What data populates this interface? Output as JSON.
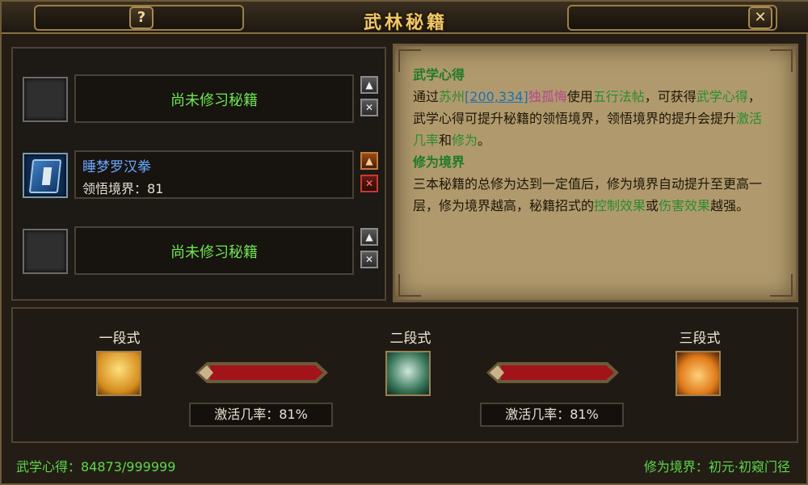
{
  "window": {
    "title": "武林秘籍",
    "help_label": "?",
    "close_label": "✕"
  },
  "slots": [
    {
      "state": "empty",
      "text": "尚未修习秘籍"
    },
    {
      "state": "filled",
      "name": "睡梦罗汉拳",
      "level_text": "领悟境界：81"
    },
    {
      "state": "empty",
      "text": "尚未修习秘籍"
    }
  ],
  "slot_buttons": {
    "up_label": "▲",
    "remove_label": "✕"
  },
  "info": {
    "section1_title": "武学心得",
    "p1_a": "通过",
    "p1_place": "苏州",
    "p1_coord": "[200,334]",
    "p1_npc": "独孤悔",
    "p1_b": "使用",
    "p1_item": "五行法帖",
    "p1_c": "，可获得",
    "p1_d": "武学心得",
    "p1_e": "，武学心得可提升秘籍的领悟境界，领悟境界的提升会提升",
    "p1_f": "激活几率",
    "p1_g": "和",
    "p1_h": "修为",
    "p1_i": "。",
    "section2_title": "修为境界",
    "p2_a": "三本秘籍的总修为达到一定值后，修为境界自动提升至更高一层，修为境界越高，秘籍招式的",
    "p2_b": "控制效果",
    "p2_c": "或",
    "p2_d": "伤害效果",
    "p2_e": "越强。"
  },
  "stages": [
    {
      "label": "一段式",
      "icon": "meditating-monk-icon"
    },
    {
      "label": "二段式",
      "icon": "fist-icon"
    },
    {
      "label": "三段式",
      "icon": "flaming-body-icon"
    }
  ],
  "rates": [
    {
      "text": "激活几率：81%"
    },
    {
      "text": "激活几率：81%"
    }
  ],
  "footer": {
    "left": "武学心得：84873/999999",
    "right": "修为境界：初元·初窥门径"
  },
  "colors": {
    "gold_title": "#f2c766",
    "green_text": "#6ee64f",
    "blue_name": "#6aa7ff",
    "parchment": "#b09a6d"
  }
}
